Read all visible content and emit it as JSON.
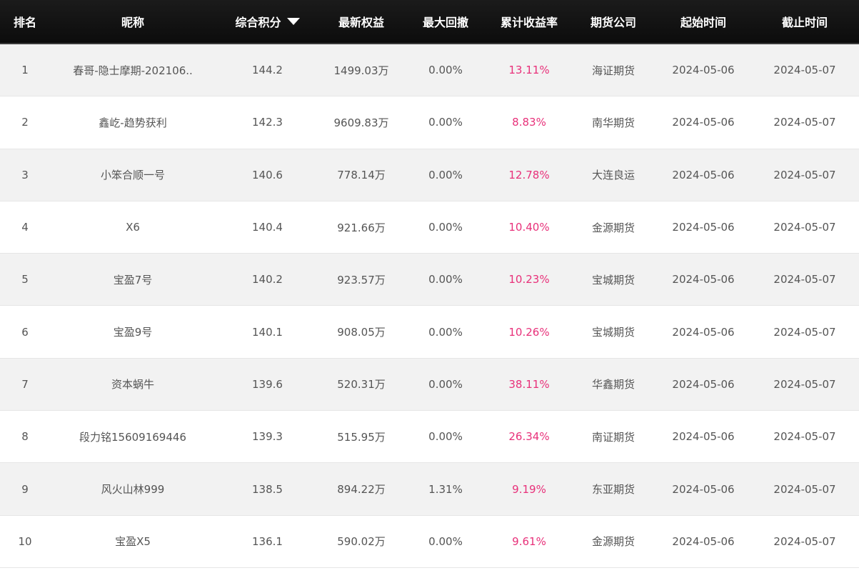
{
  "headers": {
    "rank": "排名",
    "nickname": "昵称",
    "score": "综合积分",
    "equity": "最新权益",
    "drawdown": "最大回撤",
    "return": "累计收益率",
    "company": "期货公司",
    "start": "起始时间",
    "end": "截止时间"
  },
  "colors": {
    "header_bg": "#111111",
    "return_color": "#e8317a",
    "odd_row": "#f2f2f2"
  },
  "rows": [
    {
      "rank": "1",
      "nickname": "春哥-隐士摩期-202106..",
      "score": "144.2",
      "equity": "1499.03万",
      "drawdown": "0.00%",
      "return": "13.11%",
      "company": "海证期货",
      "start": "2024-05-06",
      "end": "2024-05-07"
    },
    {
      "rank": "2",
      "nickname": "鑫屹-趋势获利",
      "score": "142.3",
      "equity": "9609.83万",
      "drawdown": "0.00%",
      "return": "8.83%",
      "company": "南华期货",
      "start": "2024-05-06",
      "end": "2024-05-07"
    },
    {
      "rank": "3",
      "nickname": "小笨合顺一号",
      "score": "140.6",
      "equity": "778.14万",
      "drawdown": "0.00%",
      "return": "12.78%",
      "company": "大连良运",
      "start": "2024-05-06",
      "end": "2024-05-07"
    },
    {
      "rank": "4",
      "nickname": "X6",
      "score": "140.4",
      "equity": "921.66万",
      "drawdown": "0.00%",
      "return": "10.40%",
      "company": "金源期货",
      "start": "2024-05-06",
      "end": "2024-05-07"
    },
    {
      "rank": "5",
      "nickname": "宝盈7号",
      "score": "140.2",
      "equity": "923.57万",
      "drawdown": "0.00%",
      "return": "10.23%",
      "company": "宝城期货",
      "start": "2024-05-06",
      "end": "2024-05-07"
    },
    {
      "rank": "6",
      "nickname": "宝盈9号",
      "score": "140.1",
      "equity": "908.05万",
      "drawdown": "0.00%",
      "return": "10.26%",
      "company": "宝城期货",
      "start": "2024-05-06",
      "end": "2024-05-07"
    },
    {
      "rank": "7",
      "nickname": "资本蜗牛",
      "score": "139.6",
      "equity": "520.31万",
      "drawdown": "0.00%",
      "return": "38.11%",
      "company": "华鑫期货",
      "start": "2024-05-06",
      "end": "2024-05-07"
    },
    {
      "rank": "8",
      "nickname": "段力铭15609169446",
      "score": "139.3",
      "equity": "515.95万",
      "drawdown": "0.00%",
      "return": "26.34%",
      "company": "南证期货",
      "start": "2024-05-06",
      "end": "2024-05-07"
    },
    {
      "rank": "9",
      "nickname": "风火山林999",
      "score": "138.5",
      "equity": "894.22万",
      "drawdown": "1.31%",
      "return": "9.19%",
      "company": "东亚期货",
      "start": "2024-05-06",
      "end": "2024-05-07"
    },
    {
      "rank": "10",
      "nickname": "宝盈X5",
      "score": "136.1",
      "equity": "590.02万",
      "drawdown": "0.00%",
      "return": "9.61%",
      "company": "金源期货",
      "start": "2024-05-06",
      "end": "2024-05-07"
    }
  ]
}
